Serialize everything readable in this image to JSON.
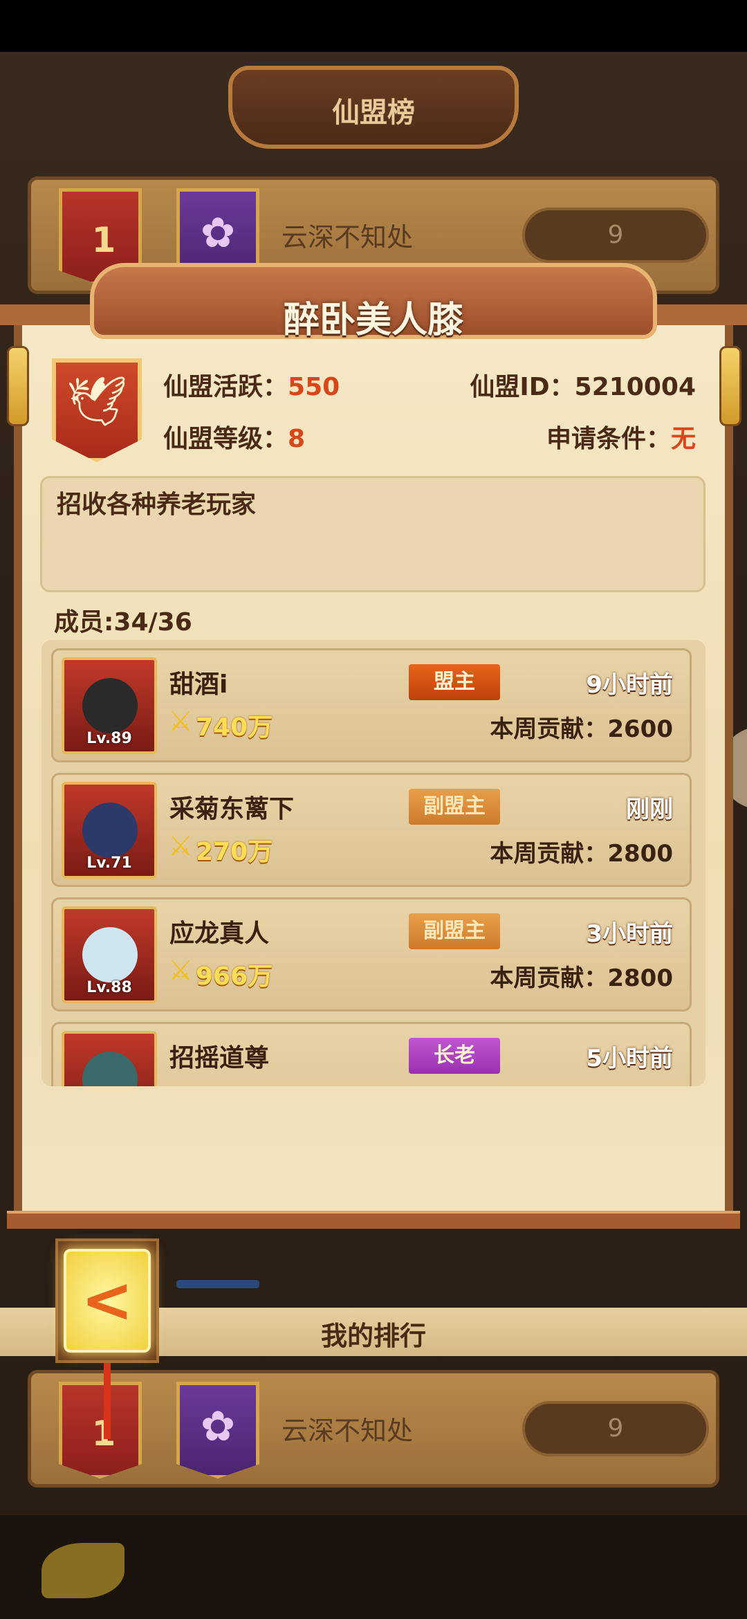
{
  "ranking": {
    "title": "仙盟榜",
    "top_entry": {
      "rank": "1",
      "name": "云深不知处",
      "score": "9"
    }
  },
  "guild": {
    "name": "醉卧美人膝",
    "activity_label": "仙盟活跃：",
    "activity_value": "550",
    "level_label": "仙盟等级：",
    "level_value": "8",
    "id_label": "仙盟ID：",
    "id_value": "5210004",
    "condition_label": "申请条件：",
    "condition_value": "无",
    "description": "招收各种养老玩家",
    "members_label": "成员:34/36"
  },
  "members": [
    {
      "name": "甜酒i",
      "level": "Lv.89",
      "power": "740万",
      "role": "盟主",
      "time": "9小时前",
      "contribution": "本周贡献：2600"
    },
    {
      "name": "采菊东蓠下",
      "level": "Lv.71",
      "power": "270万",
      "role": "副盟主",
      "time": "刚刚",
      "contribution": "本周贡献：2800"
    },
    {
      "name": "应龙真人",
      "level": "Lv.88",
      "power": "966万",
      "role": "副盟主",
      "time": "3小时前",
      "contribution": "本周贡献：2800"
    },
    {
      "name": "招摇道尊",
      "level": "",
      "power": "",
      "role": "长老",
      "time": "5小时前",
      "contribution": ""
    }
  ],
  "my_rank": {
    "label": "我的排行",
    "entry": {
      "rank": "1",
      "name": "云深不知处",
      "score": "9"
    }
  },
  "icons": {
    "back": "back-arrow-icon",
    "power": "crossed-swords-icon",
    "emblem": "phoenix-icon",
    "guild_banner": "lotus-icon"
  },
  "colors": {
    "accent": "#d8461a",
    "leader": "#e8641a",
    "vice": "#cc7a2a",
    "elder": "#9a30b0"
  }
}
